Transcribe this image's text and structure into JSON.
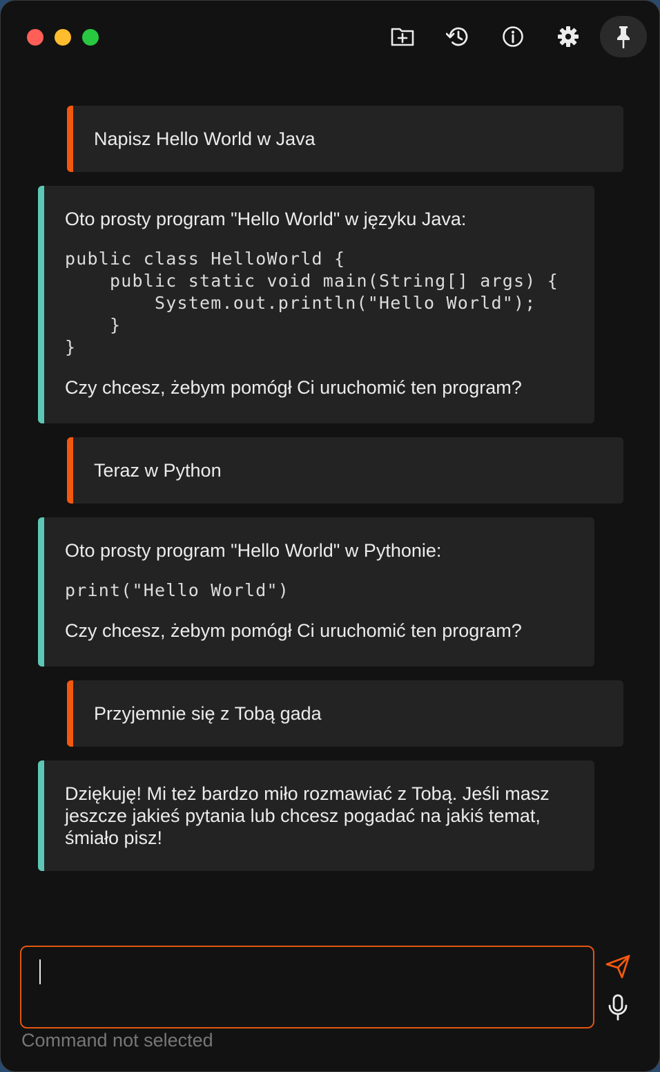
{
  "window": {
    "traffic_lights": [
      "close",
      "minimize",
      "zoom"
    ]
  },
  "toolbar": {
    "buttons": [
      {
        "icon": "folder-plus-icon",
        "label": ""
      },
      {
        "icon": "history-icon",
        "label": ""
      },
      {
        "icon": "info-icon",
        "label": ""
      },
      {
        "icon": "gear-icon",
        "label": ""
      },
      {
        "icon": "pin-icon",
        "label": "",
        "active": true
      }
    ]
  },
  "messages": [
    {
      "role": "user",
      "text": "Napisz Hello World w Java"
    },
    {
      "role": "assistant",
      "intro": "Oto prosty program \"Hello World\" w języku Java:",
      "code": "public class HelloWorld {\n    public static void main(String[] args) {\n        System.out.println(\"Hello World\");\n    }\n}",
      "outro": "Czy chcesz, żebym pomógł Ci uruchomić ten program?"
    },
    {
      "role": "user",
      "text": "Teraz w Python"
    },
    {
      "role": "assistant",
      "intro": "Oto prosty program \"Hello World\" w Pythonie:",
      "code": "print(\"Hello World\")",
      "outro": "Czy chcesz, żebym pomógł Ci uruchomić ten program?"
    },
    {
      "role": "user",
      "text": "Przyjemnie się z Tobą gada"
    },
    {
      "role": "assistant",
      "intro": "Dziękuję! Mi też bardzo miło rozmawiać z Tobą. Jeśli masz jeszcze jakieś pytania lub chcesz pogadać na jakiś temat, śmiało pisz!"
    }
  ],
  "composer": {
    "value": "",
    "send_icon": "send-icon",
    "mic_icon": "microphone-icon",
    "status": "Command not selected"
  },
  "colors": {
    "accent": "#f1590f",
    "assistant_accent": "#5cc7b4",
    "background": "#121212",
    "bubble": "#232323"
  }
}
